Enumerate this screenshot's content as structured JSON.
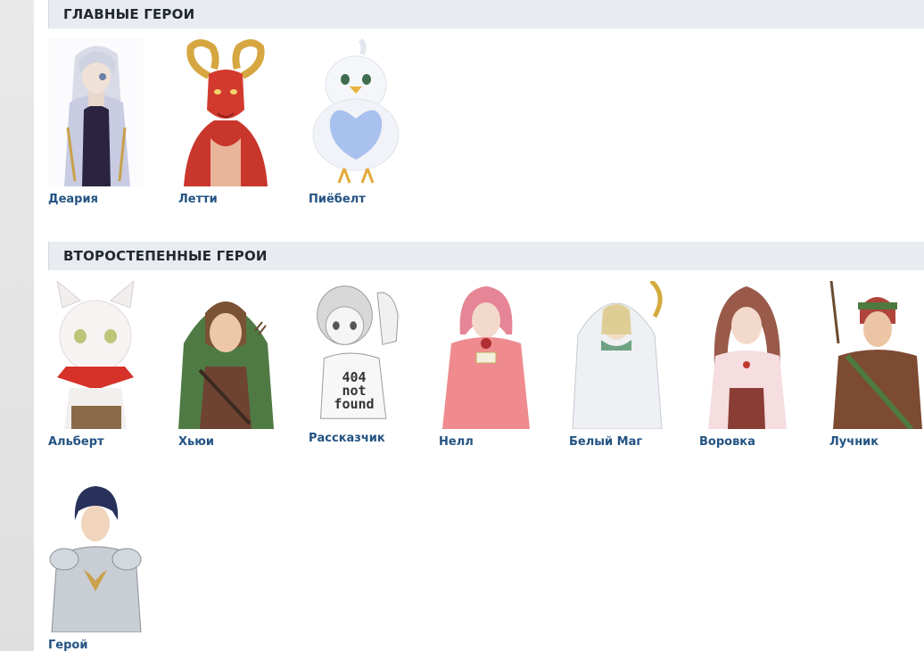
{
  "sections": {
    "main": {
      "title": "ГЛАВНЫЕ ГЕРОИ",
      "characters": [
        {
          "name": "Деария",
          "image": "white-haired-mage-portrait"
        },
        {
          "name": "Летти",
          "image": "red-dragon-portrait"
        },
        {
          "name": "Пиёбелт",
          "image": "white-bird-portrait"
        }
      ]
    },
    "secondary": {
      "title": "ВТОРОСТЕПЕННЫЕ ГЕРОИ",
      "characters": [
        {
          "name": "Альберт",
          "image": "white-cat-portrait"
        },
        {
          "name": "Хьюи",
          "image": "green-hooded-archer-portrait"
        },
        {
          "name": "Рассказчик",
          "image": "placeholder-404-portrait",
          "caption": "404 not found"
        },
        {
          "name": "Нелл",
          "image": "pink-dress-girl-portrait"
        },
        {
          "name": "Белый Маг",
          "image": "white-hooded-mage-portrait"
        },
        {
          "name": "Воровка",
          "image": "brown-haired-thief-portrait"
        },
        {
          "name": "Лучник",
          "image": "red-haired-archer-portrait"
        },
        {
          "name": "Герой",
          "image": "armored-hero-portrait"
        }
      ]
    }
  }
}
